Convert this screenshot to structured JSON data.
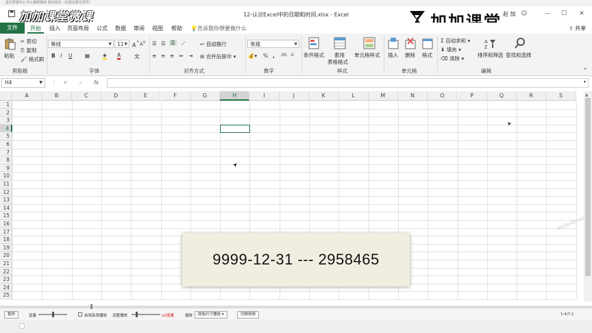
{
  "player_top": {
    "text": "首次屏幕中心可以满屏播放 拖动鼠标（右键设置可调节）"
  },
  "window": {
    "title": "12-认识Excel中的日期和时间.xlsx  -  Excel",
    "user": "赵 加"
  },
  "watermark_script": "加加课堂微课",
  "brand": {
    "name": "加加课堂"
  },
  "menu": {
    "file": "文件",
    "tabs": [
      "开始",
      "插入",
      "页面布局",
      "公式",
      "数据",
      "审阅",
      "视图",
      "帮助"
    ],
    "tell_me": "告诉我你想要做什么",
    "share": "共享"
  },
  "ribbon": {
    "clipboard": {
      "paste": "粘贴",
      "cut": "剪切",
      "copy": "复制",
      "format_painter": "格式刷",
      "label": "剪贴板"
    },
    "font": {
      "font_name": "等线",
      "font_size": "11",
      "bold": "B",
      "italic": "I",
      "underline": "U",
      "label": "字体"
    },
    "alignment": {
      "wrap": "自动换行",
      "merge": "合并后居中",
      "label": "对齐方式"
    },
    "number": {
      "format": "常规",
      "percent": "%",
      "comma": ",",
      "label": "数字"
    },
    "styles": {
      "conditional": "条件格式",
      "table_line1": "套用",
      "table_line2": "表格格式",
      "cell_styles": "单元格样式",
      "label": "样式"
    },
    "cells": {
      "insert": "插入",
      "delete": "删除",
      "format": "格式",
      "label": "单元格"
    },
    "editing": {
      "autosum": "自动求和",
      "fill": "填充",
      "clear": "清除",
      "sort": "排序和筛选",
      "find": "查找和选择",
      "label": "编辑"
    }
  },
  "formula_bar": {
    "name_box": "H4",
    "fx": "fx",
    "content": ""
  },
  "sheet": {
    "columns": [
      "A",
      "B",
      "C",
      "D",
      "E",
      "F",
      "G",
      "H",
      "I",
      "J",
      "K",
      "L",
      "M",
      "N",
      "O",
      "P",
      "Q",
      "R",
      "S"
    ],
    "rows": [
      "1",
      "2",
      "3",
      "4",
      "5",
      "6",
      "7",
      "8",
      "9",
      "10",
      "11",
      "12",
      "13",
      "14",
      "15",
      "16",
      "17",
      "18",
      "19",
      "20",
      "21",
      "22",
      "23",
      "24",
      "25"
    ],
    "active_cell": "H4"
  },
  "overlay": {
    "text": "9999-12-31  ---  2958465"
  },
  "diag_watermark": "zichardshao",
  "player_bar": {
    "pause": "暂停",
    "volume": "音量",
    "hd": "启用高清播放",
    "speed": "设置播放",
    "speed_value": "x1倍速",
    "zoom": "缩放",
    "zoom_value": "原始尺寸播放",
    "switch": "切换视频",
    "time": "1:4/7:1"
  }
}
